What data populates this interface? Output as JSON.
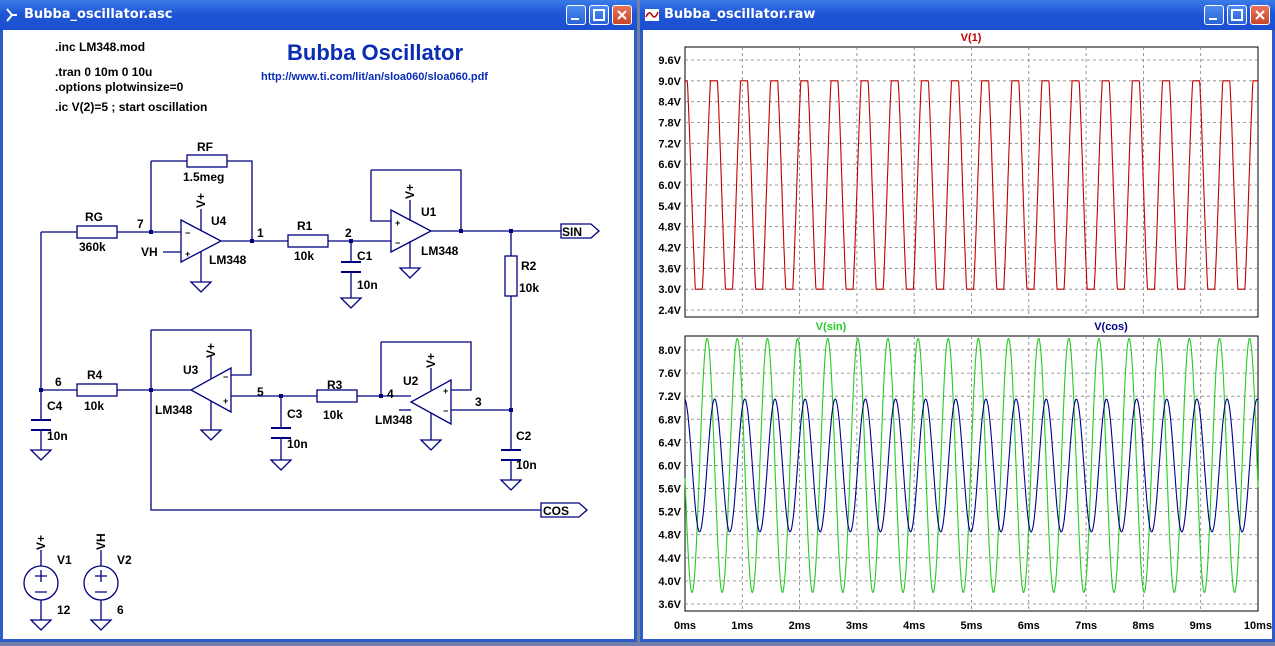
{
  "schematic_window": {
    "title": "Bubba_oscillator.asc",
    "directives": [
      ".inc LM348.mod",
      ".tran 0 10m 0 10u",
      ".options plotwinsize=0",
      ".ic V(2)=5 ; start oscillation"
    ],
    "heading": "Bubba Oscillator",
    "link": "http://www.ti.com/lit/an/sloa060/sloa060.pdf",
    "components": {
      "rf_name": "RF",
      "rf_value": "1.5meg",
      "rg_name": "RG",
      "rg_value": "360k",
      "r1_name": "R1",
      "r1_value": "10k",
      "r2_name": "R2",
      "r2_value": "10k",
      "r3_name": "R3",
      "r3_value": "10k",
      "r4_name": "R4",
      "r4_value": "10k",
      "c1_name": "C1",
      "c1_value": "10n",
      "c2_name": "C2",
      "c2_value": "10n",
      "c3_name": "C3",
      "c3_value": "10n",
      "c4_name": "C4",
      "c4_value": "10n",
      "u1": "U1",
      "u2": "U2",
      "u3": "U3",
      "u4": "U4",
      "opamp_model": "LM348",
      "supply_label": "V+",
      "vh_label": "VH",
      "v1_name": "V1",
      "v1_value": "12",
      "v2_name": "V2",
      "v2_value": "6"
    },
    "nodes": {
      "n1": "1",
      "n2": "2",
      "n3": "3",
      "n4": "4",
      "n5": "5",
      "n6": "6",
      "n7": "7"
    },
    "ports": {
      "sin": "SIN",
      "cos": "COS"
    }
  },
  "waveform_window": {
    "title": "Bubba_oscillator.raw",
    "x_ticks": [
      "0ms",
      "1ms",
      "2ms",
      "3ms",
      "4ms",
      "5ms",
      "6ms",
      "7ms",
      "8ms",
      "9ms",
      "10ms"
    ]
  },
  "chart_data": [
    {
      "type": "line",
      "series": [
        {
          "name": "V(1)",
          "color": "#c00000",
          "period_ms": 0.526,
          "min": 3.0,
          "max": 9.0,
          "start": 8.9
        }
      ],
      "x_range_ms": [
        0,
        10
      ],
      "y_ticks": [
        "9.6V",
        "9.0V",
        "8.4V",
        "7.8V",
        "7.2V",
        "6.6V",
        "6.0V",
        "5.4V",
        "4.8V",
        "4.2V",
        "3.6V",
        "3.0V",
        "2.4V"
      ],
      "ylim": [
        2.4,
        9.6
      ],
      "grid": true
    },
    {
      "type": "line",
      "series": [
        {
          "name": "V(sin)",
          "color": "#22cc22",
          "period_ms": 0.526,
          "center": 6.0,
          "amplitude": 2.2
        },
        {
          "name": "V(cos)",
          "color": "#00008b",
          "period_ms": 0.526,
          "center": 6.0,
          "amplitude": 1.15
        }
      ],
      "x_range_ms": [
        0,
        10
      ],
      "y_ticks": [
        "8.0V",
        "7.6V",
        "7.2V",
        "6.8V",
        "6.4V",
        "6.0V",
        "5.6V",
        "5.2V",
        "4.8V",
        "4.4V",
        "4.0V",
        "3.6V"
      ],
      "ylim": [
        3.6,
        8.2
      ],
      "grid": true
    }
  ],
  "colors": {
    "title_bar": "#1f56d6",
    "heading": "#0a2db4",
    "wire": "#000080",
    "grid": "#808080"
  }
}
